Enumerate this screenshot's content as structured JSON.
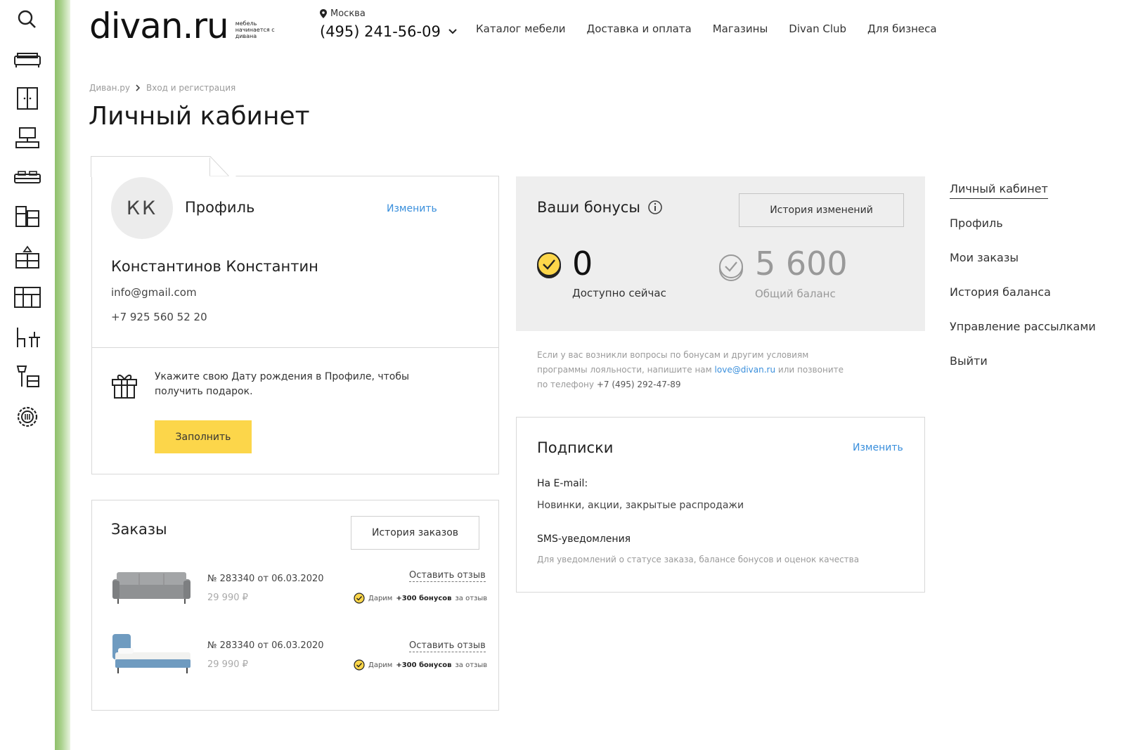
{
  "header": {
    "logo": "divan.ru",
    "logo_tagline": "мебель начинается с дивана",
    "city": "Москва",
    "phone": "(495) 241-56-09",
    "nav": [
      "Каталог мебели",
      "Доставка и оплата",
      "Магазины",
      "Divan Club",
      "Для бизнеса"
    ]
  },
  "breadcrumb": [
    "Диван.ру",
    "Вход и регистрация"
  ],
  "page_title": "Личный кабинет",
  "profile": {
    "avatar_initials": "КК",
    "label": "Профиль",
    "edit_label": "Изменить",
    "name": "Константинов Константин",
    "email": "info@gmail.com",
    "phone": "+7 925 560 52 20",
    "birthday_prompt": "Укажите свою Дату рождения в Профиле, чтобы получить подарок.",
    "fill_button": "Заполнить"
  },
  "orders": {
    "title": "Заказы",
    "history_button": "История заказов",
    "items": [
      {
        "number": "№ 283340 от 06.03.2020",
        "price": "29 990 ₽",
        "review": "Оставить отзыв",
        "bonus_prefix": "Дарим",
        "bonus_amount": "+300 бонусов",
        "bonus_suffix": "за отзыв",
        "image": "sofa"
      },
      {
        "number": "№ 283340 от 06.03.2020",
        "price": "29 990 ₽",
        "review": "Оставить отзыв",
        "bonus_prefix": "Дарим",
        "bonus_amount": "+300 бонусов",
        "bonus_suffix": "за отзыв",
        "image": "bed"
      }
    ]
  },
  "bonuses": {
    "title": "Ваши бонусы",
    "history_button": "История изменений",
    "available_value": "0",
    "available_label": "Доступно сейчас",
    "total_value": "5 600",
    "total_label": "Общий баланс",
    "note_text": "Если у вас возникли вопросы по бонусам и другим условиям программы лояльности, напишите нам",
    "note_email": "love@divan.ru",
    "note_or": "или позвоните по телефону",
    "note_phone": "+7 (495) 292-47-89"
  },
  "subscriptions": {
    "title": "Подписки",
    "edit_label": "Изменить",
    "email_label": "На E-mail:",
    "email_value": "Новинки, акции, закрытые распродажи",
    "sms_label": "SMS-уведомления",
    "sms_value": "Для уведомлений о статусе заказа, балансе бонусов и оценок качества"
  },
  "side_menu": [
    "Личный кабинет",
    "Профиль",
    "Мои заказы",
    "История баланса",
    "Управление рассылками",
    "Выйти"
  ],
  "rail_icons": [
    "search-icon",
    "sofa-icon",
    "wardrobe-icon",
    "desk-icon",
    "bed-icon",
    "shelving-icon",
    "dresser-icon",
    "kitchen-icon",
    "chair-table-icon",
    "lamp-icon",
    "settings-icon"
  ],
  "colors": {
    "accent_yellow": "#fcd64a",
    "link_blue": "#3a8fdc",
    "rail_green": "#8fc06b",
    "bonus_bg": "#eeeeee"
  }
}
